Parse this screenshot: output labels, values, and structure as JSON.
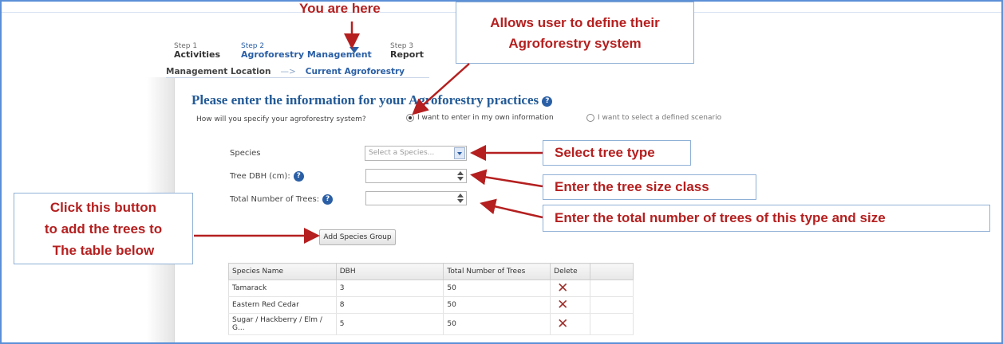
{
  "annotations": {
    "you_are_here": "You are here",
    "allows_define": [
      "Allows user to define their",
      "Agroforestry system"
    ],
    "select_tree_type": "Select tree type",
    "enter_size_class": "Enter the tree size class",
    "enter_total_number": "Enter the total number of trees of this type and size",
    "click_button": [
      "Click this button",
      "to add the trees to",
      "The table below"
    ]
  },
  "steps": [
    {
      "num": "Step 1",
      "name": "Activities"
    },
    {
      "num": "Step 2",
      "name": "Agroforestry Management"
    },
    {
      "num": "Step 3",
      "name": "Report"
    }
  ],
  "breadcrumb": {
    "first": "Management Location",
    "sep": "—>",
    "current": "Current Agroforestry"
  },
  "form": {
    "heading": "Please enter the information for your Agroforestry practices",
    "question": "How will you specify your agroforestry system?",
    "option_own": "I want to enter in my own information",
    "option_defined": "I want to select a defined scenario",
    "species_label": "Species",
    "species_placeholder": "Select a Species...",
    "dbh_label": "Tree DBH (cm):",
    "total_label": "Total Number of Trees:",
    "add_button": "Add Species Group"
  },
  "table": {
    "headers": [
      "Species Name",
      "DBH",
      "Total Number of Trees",
      "Delete"
    ],
    "rows": [
      {
        "species": "Tamarack",
        "dbh": "3",
        "total": "50",
        "delete": "✕"
      },
      {
        "species": "Eastern Red Cedar",
        "dbh": "8",
        "total": "50",
        "delete": "✕"
      },
      {
        "species": "Sugar / Hackberry / Elm / G...",
        "dbh": "5",
        "total": "50",
        "delete": "✕"
      }
    ]
  },
  "colors": {
    "annotation_red": "#b51f1f",
    "link_blue": "#2a5fa6",
    "callout_border": "#8fb0d6"
  }
}
